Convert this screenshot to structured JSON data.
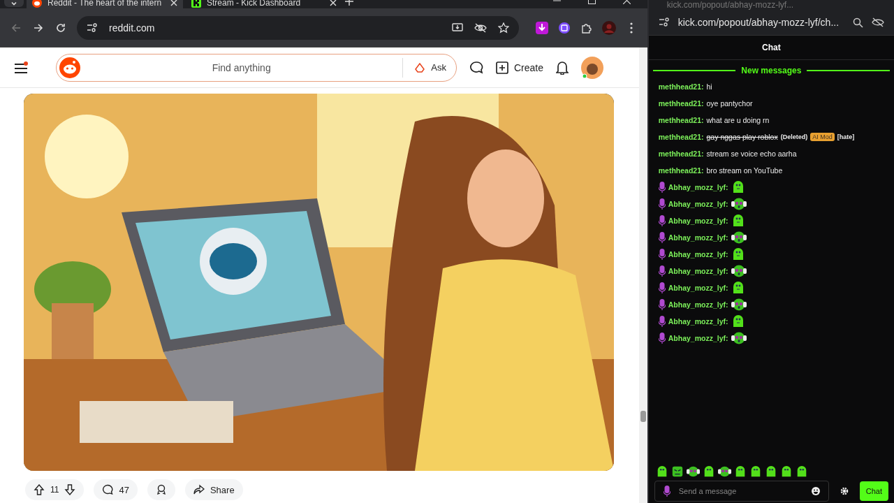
{
  "browser": {
    "tabs": [
      {
        "title": "Reddit - The heart of the intern",
        "kind": "reddit",
        "selected": true
      },
      {
        "title": "Stream - Kick Dashboard",
        "kind": "kick",
        "selected": false
      }
    ],
    "address": "reddit.com"
  },
  "reddit": {
    "search": {
      "placeholder": "Find anything"
    },
    "ask": "Ask",
    "create": "Create",
    "notification_dot": true,
    "post": {
      "votes": "11",
      "comments": "47",
      "share": "Share"
    }
  },
  "popup": {
    "title": "kick.com/popout/abhay-mozz-lyf...",
    "address": "kick.com/popout/abhay-mozz-lyf/ch...",
    "chat": {
      "header": "Chat",
      "divider": "New messages",
      "messages": [
        {
          "user": "methhead21:",
          "text": "hi",
          "deleted": false
        },
        {
          "user": "methhead21:",
          "text": "oye pantychor",
          "deleted": false
        },
        {
          "user": "methhead21:",
          "text": "what are u doing rn",
          "deleted": false
        },
        {
          "user": "methhead21:",
          "text": "gay nggas play roblox",
          "deleted": true,
          "note": "(Deleted)",
          "mod_tag": "AI Mod",
          "reason": "[hate]"
        },
        {
          "user": "methhead21:",
          "text": "stream se voice echo aarha",
          "deleted": false
        },
        {
          "user": "methhead21:",
          "text": "bro stream on YouTube",
          "deleted": false
        },
        {
          "user": "Abhay_mozz_lyf:",
          "badge": true,
          "kind": "blob"
        },
        {
          "user": "Abhay_mozz_lyf:",
          "badge": true,
          "kind": "headphones"
        },
        {
          "user": "Abhay_mozz_lyf:",
          "badge": true,
          "kind": "blob"
        },
        {
          "user": "Abhay_mozz_lyf:",
          "badge": true,
          "kind": "headphones"
        },
        {
          "user": "Abhay_mozz_lyf:",
          "badge": true,
          "kind": "blob"
        },
        {
          "user": "Abhay_mozz_lyf:",
          "badge": true,
          "kind": "headphones"
        },
        {
          "user": "Abhay_mozz_lyf:",
          "badge": true,
          "kind": "blob"
        },
        {
          "user": "Abhay_mozz_lyf:",
          "badge": true,
          "kind": "headphones"
        },
        {
          "user": "Abhay_mozz_lyf:",
          "badge": true,
          "kind": "blob"
        },
        {
          "user": "Abhay_mozz_lyf:",
          "badge": true,
          "kind": "headphones"
        }
      ],
      "emote_bar": [
        {
          "kind": "blob"
        },
        {
          "kind": "square"
        },
        {
          "kind": "headphones"
        },
        {
          "kind": "blob"
        },
        {
          "kind": "headphones"
        },
        {
          "kind": "blob"
        },
        {
          "kind": "blob"
        },
        {
          "kind": "blob"
        },
        {
          "kind": "blob"
        },
        {
          "kind": "blob"
        }
      ],
      "input": {
        "placeholder": "Send a message"
      },
      "send": "Chat"
    }
  }
}
